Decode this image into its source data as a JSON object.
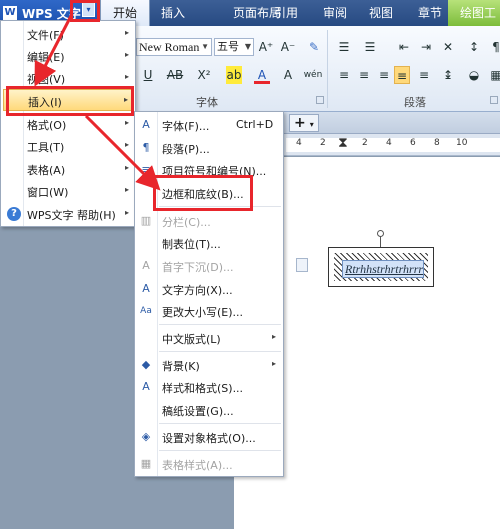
{
  "app": {
    "name": "WPS 文字",
    "logo": "W"
  },
  "menu_dropdown_icon": "menu-dropdown-icon",
  "tabs": [
    "开始",
    "插入",
    "页面布局",
    "引用",
    "审阅",
    "视图",
    "章节",
    "绘图工"
  ],
  "ribbon": {
    "font_name": "New Roman",
    "font_size": "五号",
    "grow_font": "A⁺",
    "shrink_font": "A⁻",
    "font_group_label": "字体",
    "paragraph_group_label": "段落",
    "underline": "U",
    "strike": "AB",
    "superscript": "X²",
    "text_color": "A",
    "highlight": "ab",
    "clear_format": "A",
    "phonetic": "wén"
  },
  "ruler_numbers": [
    "4",
    "2",
    "2",
    "4",
    "6",
    "8",
    "10"
  ],
  "page": {
    "textbox_text": "Rtrhhstrhrtrhrrr"
  },
  "main_menu": {
    "items": [
      {
        "label": "文件(F)",
        "arrow": "▸"
      },
      {
        "label": "编辑(E)",
        "arrow": "▸"
      },
      {
        "label": "视图(V)",
        "arrow": "▸"
      },
      {
        "label": "插入(I)",
        "arrow": "▸"
      },
      {
        "label": "格式(O)",
        "arrow": "▸"
      },
      {
        "label": "工具(T)",
        "arrow": "▸"
      },
      {
        "label": "表格(A)",
        "arrow": "▸"
      },
      {
        "label": "窗口(W)",
        "arrow": "▸"
      },
      {
        "label": "WPS文字 帮助(H)",
        "arrow": "▸"
      }
    ]
  },
  "submenu": {
    "items": [
      {
        "label": "字体(F)...",
        "shortcut": "Ctrl+D",
        "icon": "A",
        "disabled": false
      },
      {
        "label": "段落(P)...",
        "icon": "¶",
        "disabled": false
      },
      {
        "label": "项目符号和编号(N)...",
        "icon": "≡",
        "disabled": false
      },
      {
        "label": "边框和底纹(B)...",
        "icon": "",
        "disabled": false
      },
      {
        "label": "分栏(C)...",
        "icon": "▥",
        "disabled": true
      },
      {
        "label": "制表位(T)...",
        "icon": "",
        "disabled": false
      },
      {
        "label": "首字下沉(D)...",
        "icon": "A",
        "disabled": true
      },
      {
        "label": "文字方向(X)...",
        "icon": "A",
        "disabled": false
      },
      {
        "label": "更改大小写(E)...",
        "icon": "Aa",
        "disabled": false
      },
      {
        "label": "中文版式(L)",
        "arrow": "▸",
        "icon": "",
        "disabled": false
      },
      {
        "label": "背景(K)",
        "arrow": "▸",
        "icon": "◆",
        "disabled": false
      },
      {
        "label": "样式和格式(S)...",
        "icon": "A",
        "disabled": false
      },
      {
        "label": "稿纸设置(G)...",
        "icon": "",
        "disabled": false
      },
      {
        "label": "设置对象格式(O)...",
        "icon": "◈",
        "disabled": false
      },
      {
        "label": "表格样式(A)...",
        "icon": "▦",
        "disabled": true
      }
    ]
  },
  "colors": {
    "annotation_red": "#e8262c",
    "menu_highlight": "#ffd97b",
    "title_blue": "#274a82"
  }
}
